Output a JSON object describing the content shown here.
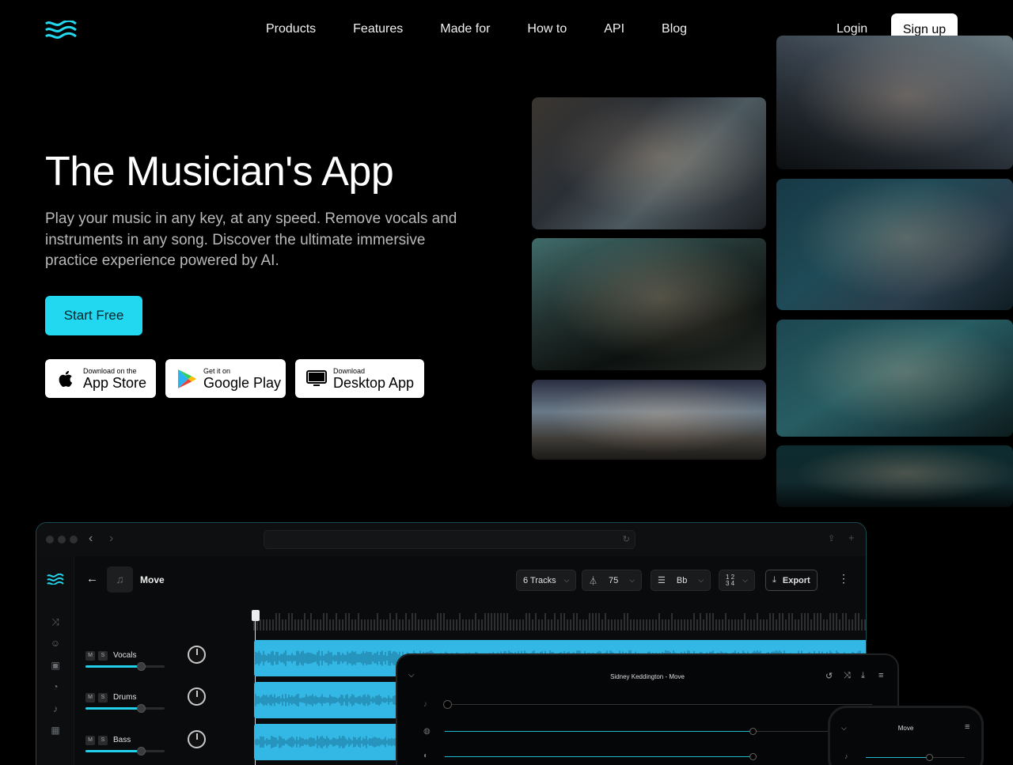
{
  "nav": {
    "logo_icon": "waves-logo-icon",
    "links": [
      "Products",
      "Features",
      "Made for",
      "How to",
      "API",
      "Blog"
    ],
    "login": "Login",
    "signup": "Sign up"
  },
  "hero": {
    "title": "The Musician's App",
    "description": "Play your music in any key, at any speed. Remove vocals and instruments in any song. Discover the ultimate immersive practice experience powered by AI.",
    "cta": "Start Free",
    "stores": {
      "apple": {
        "small": "Download on the",
        "big": "App Store",
        "icon": "apple-icon"
      },
      "google": {
        "small": "Get it on",
        "big": "Google Play",
        "icon": "google-play-icon"
      },
      "desktop": {
        "small": "Download",
        "big": "Desktop App",
        "icon": "monitor-icon"
      }
    }
  },
  "app": {
    "song_title": "Move",
    "tracks_chip": "6 Tracks",
    "tempo": "75",
    "key": "Bb",
    "time_sig_icon": "time-signature-icon",
    "export": "Export",
    "tracks": [
      {
        "name": "Vocals",
        "mute": "M",
        "solo": "S",
        "volume": 0.7
      },
      {
        "name": "Drums",
        "mute": "M",
        "solo": "S",
        "volume": 0.7
      },
      {
        "name": "Bass",
        "mute": "M",
        "solo": "S",
        "volume": 0.7
      }
    ],
    "tablet_title": "Sidney Keddington - Move",
    "phone_title": "Move"
  },
  "colors": {
    "accent": "#22d8f0",
    "wave": "#33b8e6",
    "background": "#000000"
  }
}
